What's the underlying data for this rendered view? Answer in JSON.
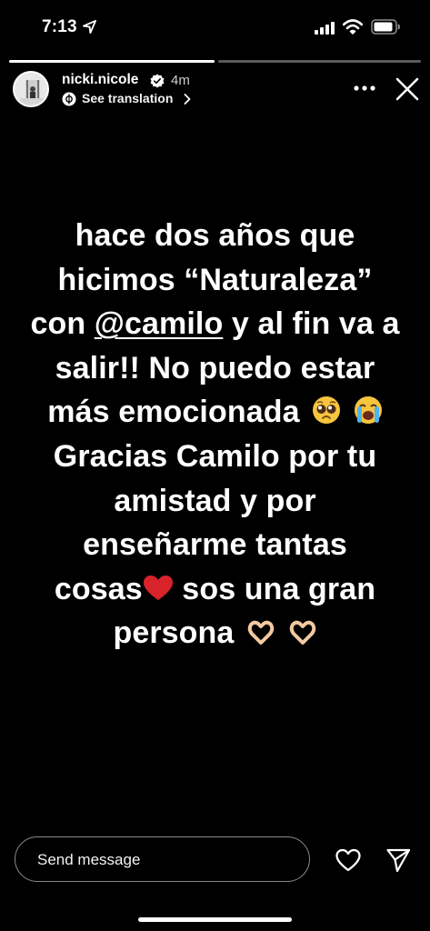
{
  "status_bar": {
    "time": "7:13",
    "icons": [
      "location-arrow-icon",
      "cellular-signal-icon",
      "wifi-icon",
      "battery-icon"
    ]
  },
  "story_progress": {
    "segments": [
      {
        "fill_fraction": 1.0
      },
      {
        "fill_fraction": 0.0
      }
    ]
  },
  "header": {
    "username": "nicki.nicole",
    "verified": true,
    "time_ago": "4m",
    "translation_label": "See translation"
  },
  "story": {
    "line1": "hace dos años que",
    "line2": "hicimos “Naturaleza”",
    "line3_prefix": "con ",
    "mention": "@camilo",
    "line3_suffix": " y al fin va a",
    "line4": "salir!! No puedo estar",
    "line5": "más emocionada",
    "line6": "Gracias Camilo por tu",
    "line7": "amistad y por",
    "line8": "enseñarme tantas",
    "line9_prefix": "cosas",
    "line9_suffix": " sos una gran",
    "line10": "persona",
    "emojis": [
      "pleading-face-emoji",
      "crying-face-emoji",
      "red-heart-emoji",
      "heart-hands-emoji"
    ]
  },
  "composer": {
    "placeholder": "Send message"
  },
  "colors": {
    "background": "#000000",
    "text": "#ffffff",
    "verified_badge": "#ffffff",
    "heart_emoji": "#d8232a"
  }
}
